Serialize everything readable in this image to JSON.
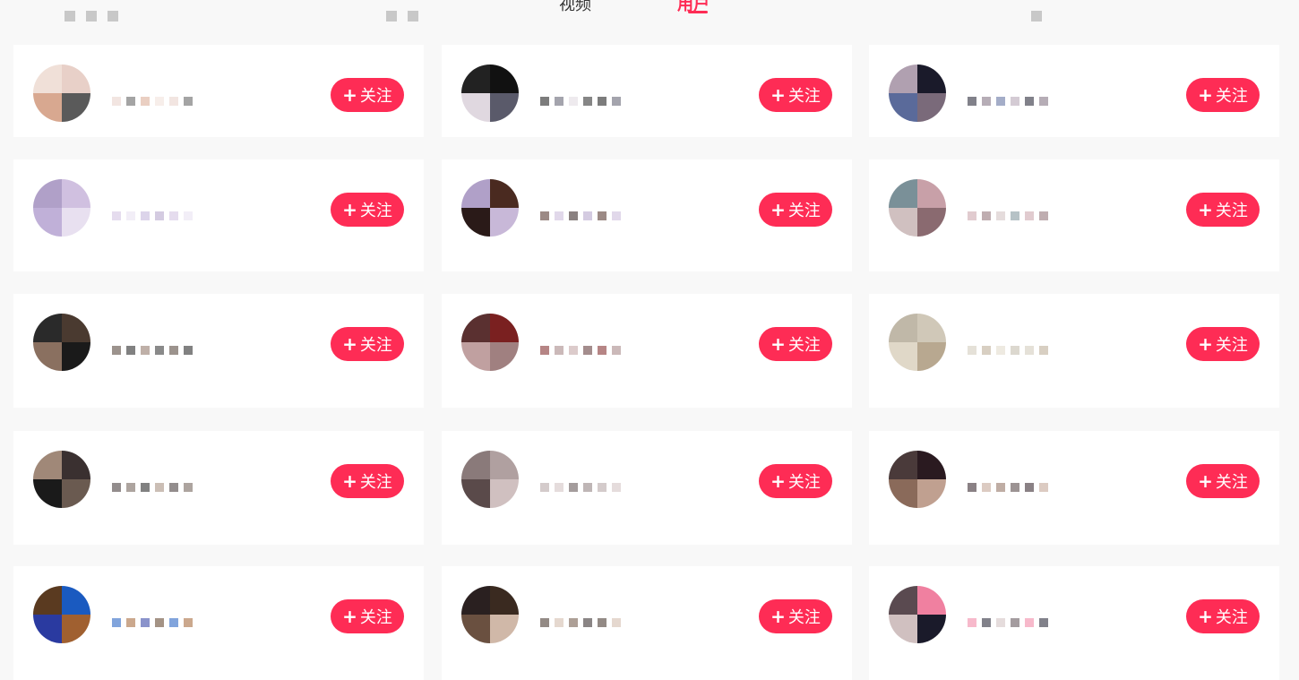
{
  "tabs": {
    "video_label": "视频",
    "user_label": "用户"
  },
  "follow_label": "关注",
  "follow_icon": "+",
  "colors": {
    "accent": "#fe2c55",
    "card_bg": "#ffffff",
    "page_bg": "#f8f8f8"
  },
  "users": [
    {
      "nickname": "",
      "avatar_colors": [
        "#e8d0c8",
        "#5a5a5a",
        "#d8a890",
        "#f0e0d8"
      ]
    },
    {
      "nickname": "",
      "avatar_colors": [
        "#111111",
        "#5a5a6a",
        "#e0d8e0",
        "#222222"
      ]
    },
    {
      "nickname": "",
      "avatar_colors": [
        "#1a1a2a",
        "#7a6a7a",
        "#5a6a9a",
        "#b0a0b0"
      ]
    },
    {
      "nickname": "",
      "avatar_colors": [
        "#d0c0e0",
        "#e8e0f0",
        "#c0b0d8",
        "#b0a0c8"
      ]
    },
    {
      "nickname": "",
      "avatar_colors": [
        "#4a2a20",
        "#c8b8d8",
        "#2a1a18",
        "#b0a0c8"
      ]
    },
    {
      "nickname": "",
      "avatar_colors": [
        "#c8a0a8",
        "#8a6a70",
        "#d0c0c0",
        "#7a9098"
      ]
    },
    {
      "nickname": "",
      "avatar_colors": [
        "#4a3a30",
        "#1a1a1a",
        "#8a7060",
        "#2a2a2a"
      ]
    },
    {
      "nickname": "",
      "avatar_colors": [
        "#7a2020",
        "#a08080",
        "#c0a0a0",
        "#5a3030"
      ]
    },
    {
      "nickname": "",
      "avatar_colors": [
        "#d0c8b8",
        "#b8a890",
        "#e0d8c8",
        "#c0b8a8"
      ]
    },
    {
      "nickname": "",
      "avatar_colors": [
        "#3a3030",
        "#6a5a50",
        "#1a1a1a",
        "#a08878"
      ]
    },
    {
      "nickname": "",
      "avatar_colors": [
        "#b0a0a0",
        "#d0c0c0",
        "#5a4a4a",
        "#8a7a7a"
      ]
    },
    {
      "nickname": "",
      "avatar_colors": [
        "#2a1a20",
        "#c0a090",
        "#8a6a5a",
        "#4a3a3a"
      ]
    },
    {
      "nickname": "",
      "avatar_colors": [
        "#1a5ac0",
        "#a06030",
        "#2a3aa0",
        "#5a3a20"
      ]
    },
    {
      "nickname": "",
      "avatar_colors": [
        "#3a2a20",
        "#d0b8a8",
        "#6a5040",
        "#2a2020"
      ]
    },
    {
      "nickname": "",
      "avatar_colors": [
        "#f080a0",
        "#1a1a2a",
        "#d0c0c0",
        "#5a4a50"
      ]
    }
  ]
}
